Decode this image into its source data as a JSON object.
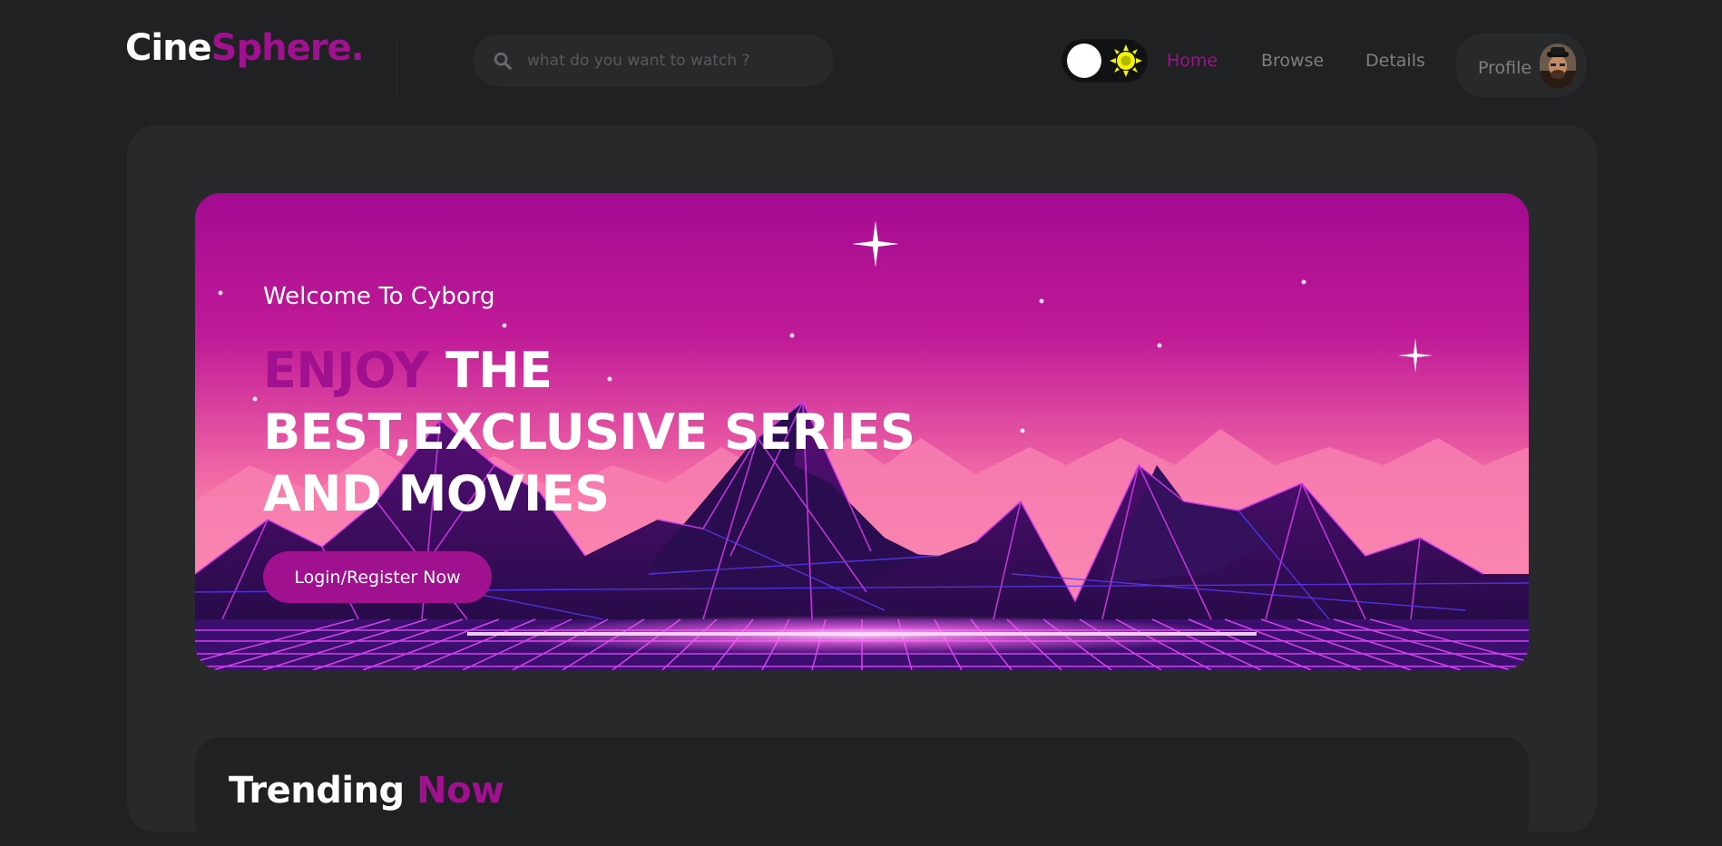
{
  "brand": {
    "logo_part1": "Cine",
    "logo_part2": "Sphere."
  },
  "search": {
    "placeholder": "what do you want to watch ?",
    "icon": "search-icon"
  },
  "theme_toggle": {
    "icon": "sun-icon",
    "state": "dark"
  },
  "nav": {
    "items": [
      {
        "label": "Home",
        "active": true
      },
      {
        "label": "Browse",
        "active": false
      },
      {
        "label": "Details",
        "active": false
      }
    ]
  },
  "profile": {
    "label": "Profile"
  },
  "hero": {
    "welcome": "Welcome To Cyborg",
    "headline_accent": "ENJOY",
    "headline_line1_rest": " THE",
    "headline_line2": "BEST,EXCLUSIVE SERIES",
    "headline_line3": "AND MOVIES",
    "cta_label": "Login/Register Now"
  },
  "trending": {
    "title_part1": "Trending ",
    "title_part2": "Now"
  },
  "colors": {
    "accent": "#a0118f",
    "background": "#1f2122",
    "panel": "#27292a",
    "sun": "#f2f20a"
  }
}
